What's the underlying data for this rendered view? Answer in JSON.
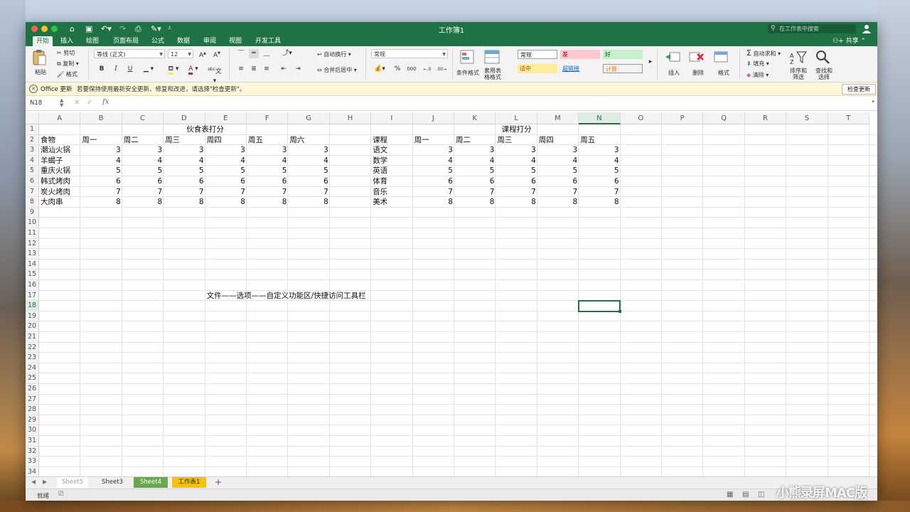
{
  "window": {
    "title": "工作簿1"
  },
  "search": {
    "placeholder": "在工作表中搜索"
  },
  "tabs": [
    "开始",
    "插入",
    "绘图",
    "页面布局",
    "公式",
    "数据",
    "审阅",
    "视图",
    "开发工具"
  ],
  "share_label": "共享",
  "ribbon": {
    "paste": "粘贴",
    "cut": "剪切",
    "copy": "复制",
    "format_painter": "格式",
    "font_name": "等线 (正文)",
    "font_size": "12",
    "bold": "B",
    "italic": "I",
    "underline": "U",
    "wrap_text": "自动换行",
    "merge_center": "合并后居中",
    "number_format": "常规",
    "percent": "%",
    "thousands": "000",
    "conditional_format": "条件格式",
    "table_format": "套用表格格式",
    "styles": [
      {
        "label": "常规",
        "bg": "#ffffff",
        "color": "#222222"
      },
      {
        "label": "差",
        "bg": "#ffc7ce",
        "color": "#9c0006"
      },
      {
        "label": "好",
        "bg": "#c6efce",
        "color": "#006100"
      },
      {
        "label": "适中",
        "bg": "#ffeb9c",
        "color": "#9c5700"
      },
      {
        "label": "超链接",
        "bg": "#f3f3f3",
        "color": "#0563c1"
      },
      {
        "label": "计算",
        "bg": "#f2f2f2",
        "color": "#fa7d00"
      }
    ],
    "insert": "插入",
    "delete": "删除",
    "format": "格式",
    "autosum": "自动求和",
    "fill": "填充",
    "clear": "清除",
    "sort_filter": "排序和筛选",
    "find_select": "查找和选择"
  },
  "infobar": {
    "title": "Office 更新",
    "message": "若要保持使用最新安全更新、修复和改进，请选择\"检查更新\"。",
    "button": "检查更新"
  },
  "formula": {
    "name_box": "N18",
    "fx": "fx",
    "value": ""
  },
  "columns": [
    "A",
    "B",
    "C",
    "D",
    "E",
    "F",
    "G",
    "H",
    "I",
    "J",
    "K",
    "L",
    "M",
    "N",
    "O",
    "P",
    "Q",
    "R",
    "S",
    "T"
  ],
  "selected_cell": {
    "col": "N",
    "row": 18
  },
  "food_table": {
    "title": "伙食表打分",
    "headers": [
      "食物",
      "周一",
      "周二",
      "周三",
      "周四",
      "周五",
      "周六"
    ],
    "rows": [
      {
        "name": "潮汕火锅",
        "values": [
          3,
          3,
          3,
          3,
          3,
          3
        ]
      },
      {
        "name": "羊蝎子",
        "values": [
          4,
          4,
          4,
          4,
          4,
          4
        ]
      },
      {
        "name": "重庆火锅",
        "values": [
          5,
          5,
          5,
          5,
          5,
          5
        ]
      },
      {
        "name": "韩式烤肉",
        "values": [
          6,
          6,
          6,
          6,
          6,
          6
        ]
      },
      {
        "name": "炭火烤肉",
        "values": [
          7,
          7,
          7,
          7,
          7,
          7
        ]
      },
      {
        "name": "大肉串",
        "values": [
          8,
          8,
          8,
          8,
          8,
          8
        ]
      }
    ]
  },
  "course_table": {
    "title": "课程打分",
    "headers": [
      "课程",
      "周一",
      "周二",
      "周三",
      "周四",
      "周五"
    ],
    "rows": [
      {
        "name": "语文",
        "values": [
          3,
          3,
          3,
          3,
          3
        ]
      },
      {
        "name": "数学",
        "values": [
          4,
          4,
          4,
          4,
          4
        ]
      },
      {
        "name": "英语",
        "values": [
          5,
          5,
          5,
          5,
          5
        ]
      },
      {
        "name": "体育",
        "values": [
          6,
          6,
          6,
          6,
          6
        ]
      },
      {
        "name": "音乐",
        "values": [
          7,
          7,
          7,
          7,
          7
        ]
      },
      {
        "name": "美术",
        "values": [
          8,
          8,
          8,
          8,
          8
        ]
      }
    ]
  },
  "note": "文件——选项——自定义功能区/快捷访问工具栏",
  "sheets": [
    {
      "label": "Sheet5",
      "bg": "#ffffff",
      "color": "#9aa0a6"
    },
    {
      "label": "Sheet3",
      "bg": "#f0f0f0",
      "color": "#333333"
    },
    {
      "label": "Sheet4",
      "bg": "#6aa84f",
      "color": "#ffffff"
    },
    {
      "label": "工作表1",
      "bg": "#f4c20d",
      "color": "#333333"
    }
  ],
  "status": {
    "ready": "就绪"
  },
  "watermark": "小熊录屏MAC版"
}
